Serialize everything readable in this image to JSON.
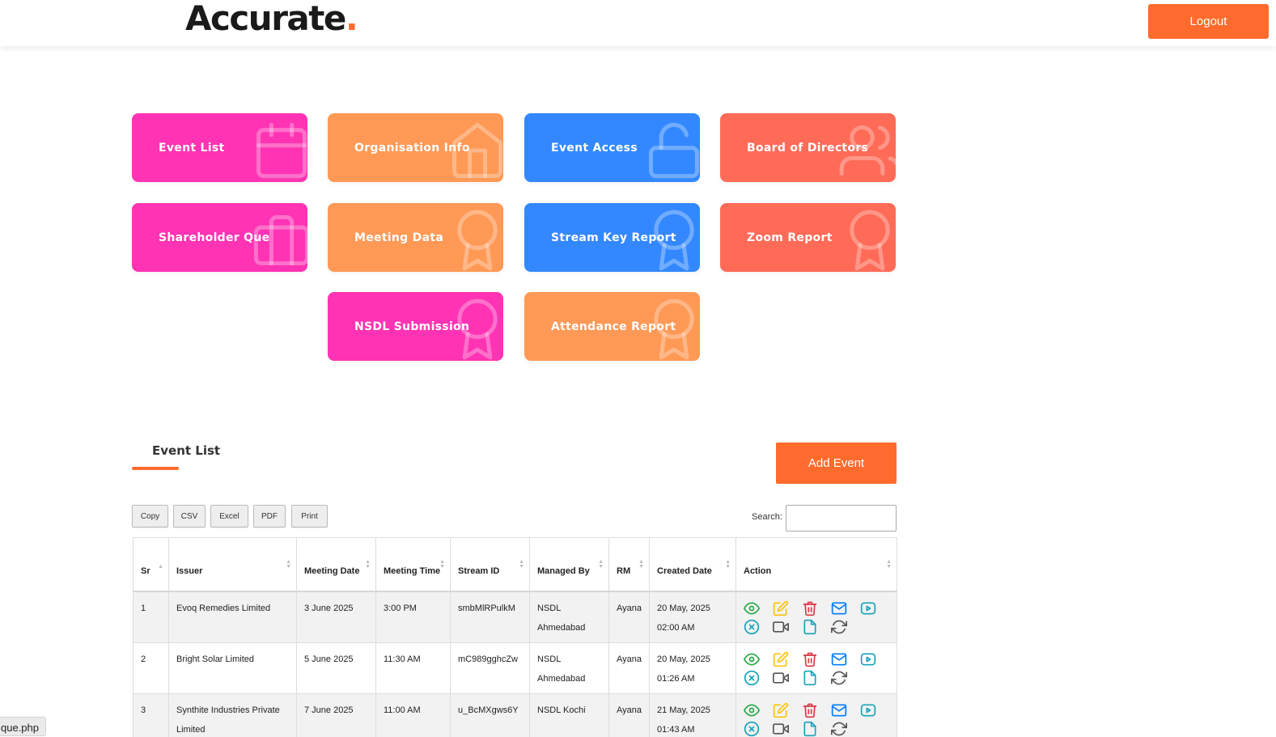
{
  "header": {
    "logo_text": "Accurate",
    "logo_dot": ".",
    "logout_label": "Logout"
  },
  "tiles": [
    {
      "label": "Event List",
      "color": "#ff33b4",
      "icon": "calendar-icon"
    },
    {
      "label": "Organisation Info",
      "color": "#ff9955",
      "icon": "home-icon"
    },
    {
      "label": "Event Access",
      "color": "#3388ff",
      "icon": "unlock-icon"
    },
    {
      "label": "Board of Directors",
      "color": "#ff6b57",
      "icon": "users-icon"
    },
    {
      "label": "Shareholder Que",
      "color": "#ff33b4",
      "icon": "briefcase-icon"
    },
    {
      "label": "Meeting Data",
      "color": "#ff9955",
      "icon": "award-icon"
    },
    {
      "label": "Stream Key Report",
      "color": "#3388ff",
      "icon": "award-icon"
    },
    {
      "label": "Zoom Report",
      "color": "#ff6b57",
      "icon": "award-icon"
    },
    {
      "label": "NSDL Submission",
      "color": "#ff33b4",
      "icon": "award-icon"
    },
    {
      "label": "Attendance Report",
      "color": "#ff9955",
      "icon": "award-icon"
    }
  ],
  "event_list": {
    "title": "Event List",
    "add_button": "Add Event",
    "export_buttons": [
      "Copy",
      "CSV",
      "Excel",
      "PDF",
      "Print"
    ],
    "search_label": "Search:",
    "search_value": "",
    "columns": [
      "Sr",
      "Issuer",
      "Meeting Date",
      "Meeting Time",
      "Stream ID",
      "Managed By",
      "RM",
      "Created Date",
      "Action"
    ],
    "rows": [
      {
        "sr": "1",
        "issuer": "Evoq Remedies Limited",
        "meeting_date": "3 June 2025",
        "meeting_time": "3:00 PM",
        "stream_id": "smbMlRPulkM",
        "managed_by": "NSDL Ahmedabad",
        "rm": "Ayana",
        "created_date": "20 May, 2025 02:00 AM"
      },
      {
        "sr": "2",
        "issuer": "Bright Solar Limited",
        "meeting_date": "5 June 2025",
        "meeting_time": "11:30 AM",
        "stream_id": "mC989gghcZw",
        "managed_by": "NSDL Ahmedabad",
        "rm": "Ayana",
        "created_date": "20 May, 2025 01:26 AM"
      },
      {
        "sr": "3",
        "issuer": "Synthite Industries Private Limited",
        "meeting_date": "7 June 2025",
        "meeting_time": "11:00 AM",
        "stream_id": "u_BcMXgws6Y",
        "managed_by": "NSDL Kochi",
        "rm": "Ayana",
        "created_date": "21 May, 2025 01:43 AM"
      }
    ],
    "action_icons": [
      "view-icon",
      "edit-icon",
      "delete-icon",
      "mail-icon",
      "play-icon",
      "cancel-icon",
      "video-icon",
      "file-icon",
      "refresh-icon"
    ],
    "action_colors": {
      "view": "#28a745",
      "edit": "#ffc107",
      "delete": "#dc3545",
      "mail": "#007bff",
      "play": "#17a2b8",
      "cancel": "#17a2b8",
      "video": "#555555",
      "file": "#17a2b8",
      "refresh": "#555555"
    }
  },
  "status_bar": {
    "text": "que.php"
  },
  "colors": {
    "accent": "#ff6b2c"
  }
}
